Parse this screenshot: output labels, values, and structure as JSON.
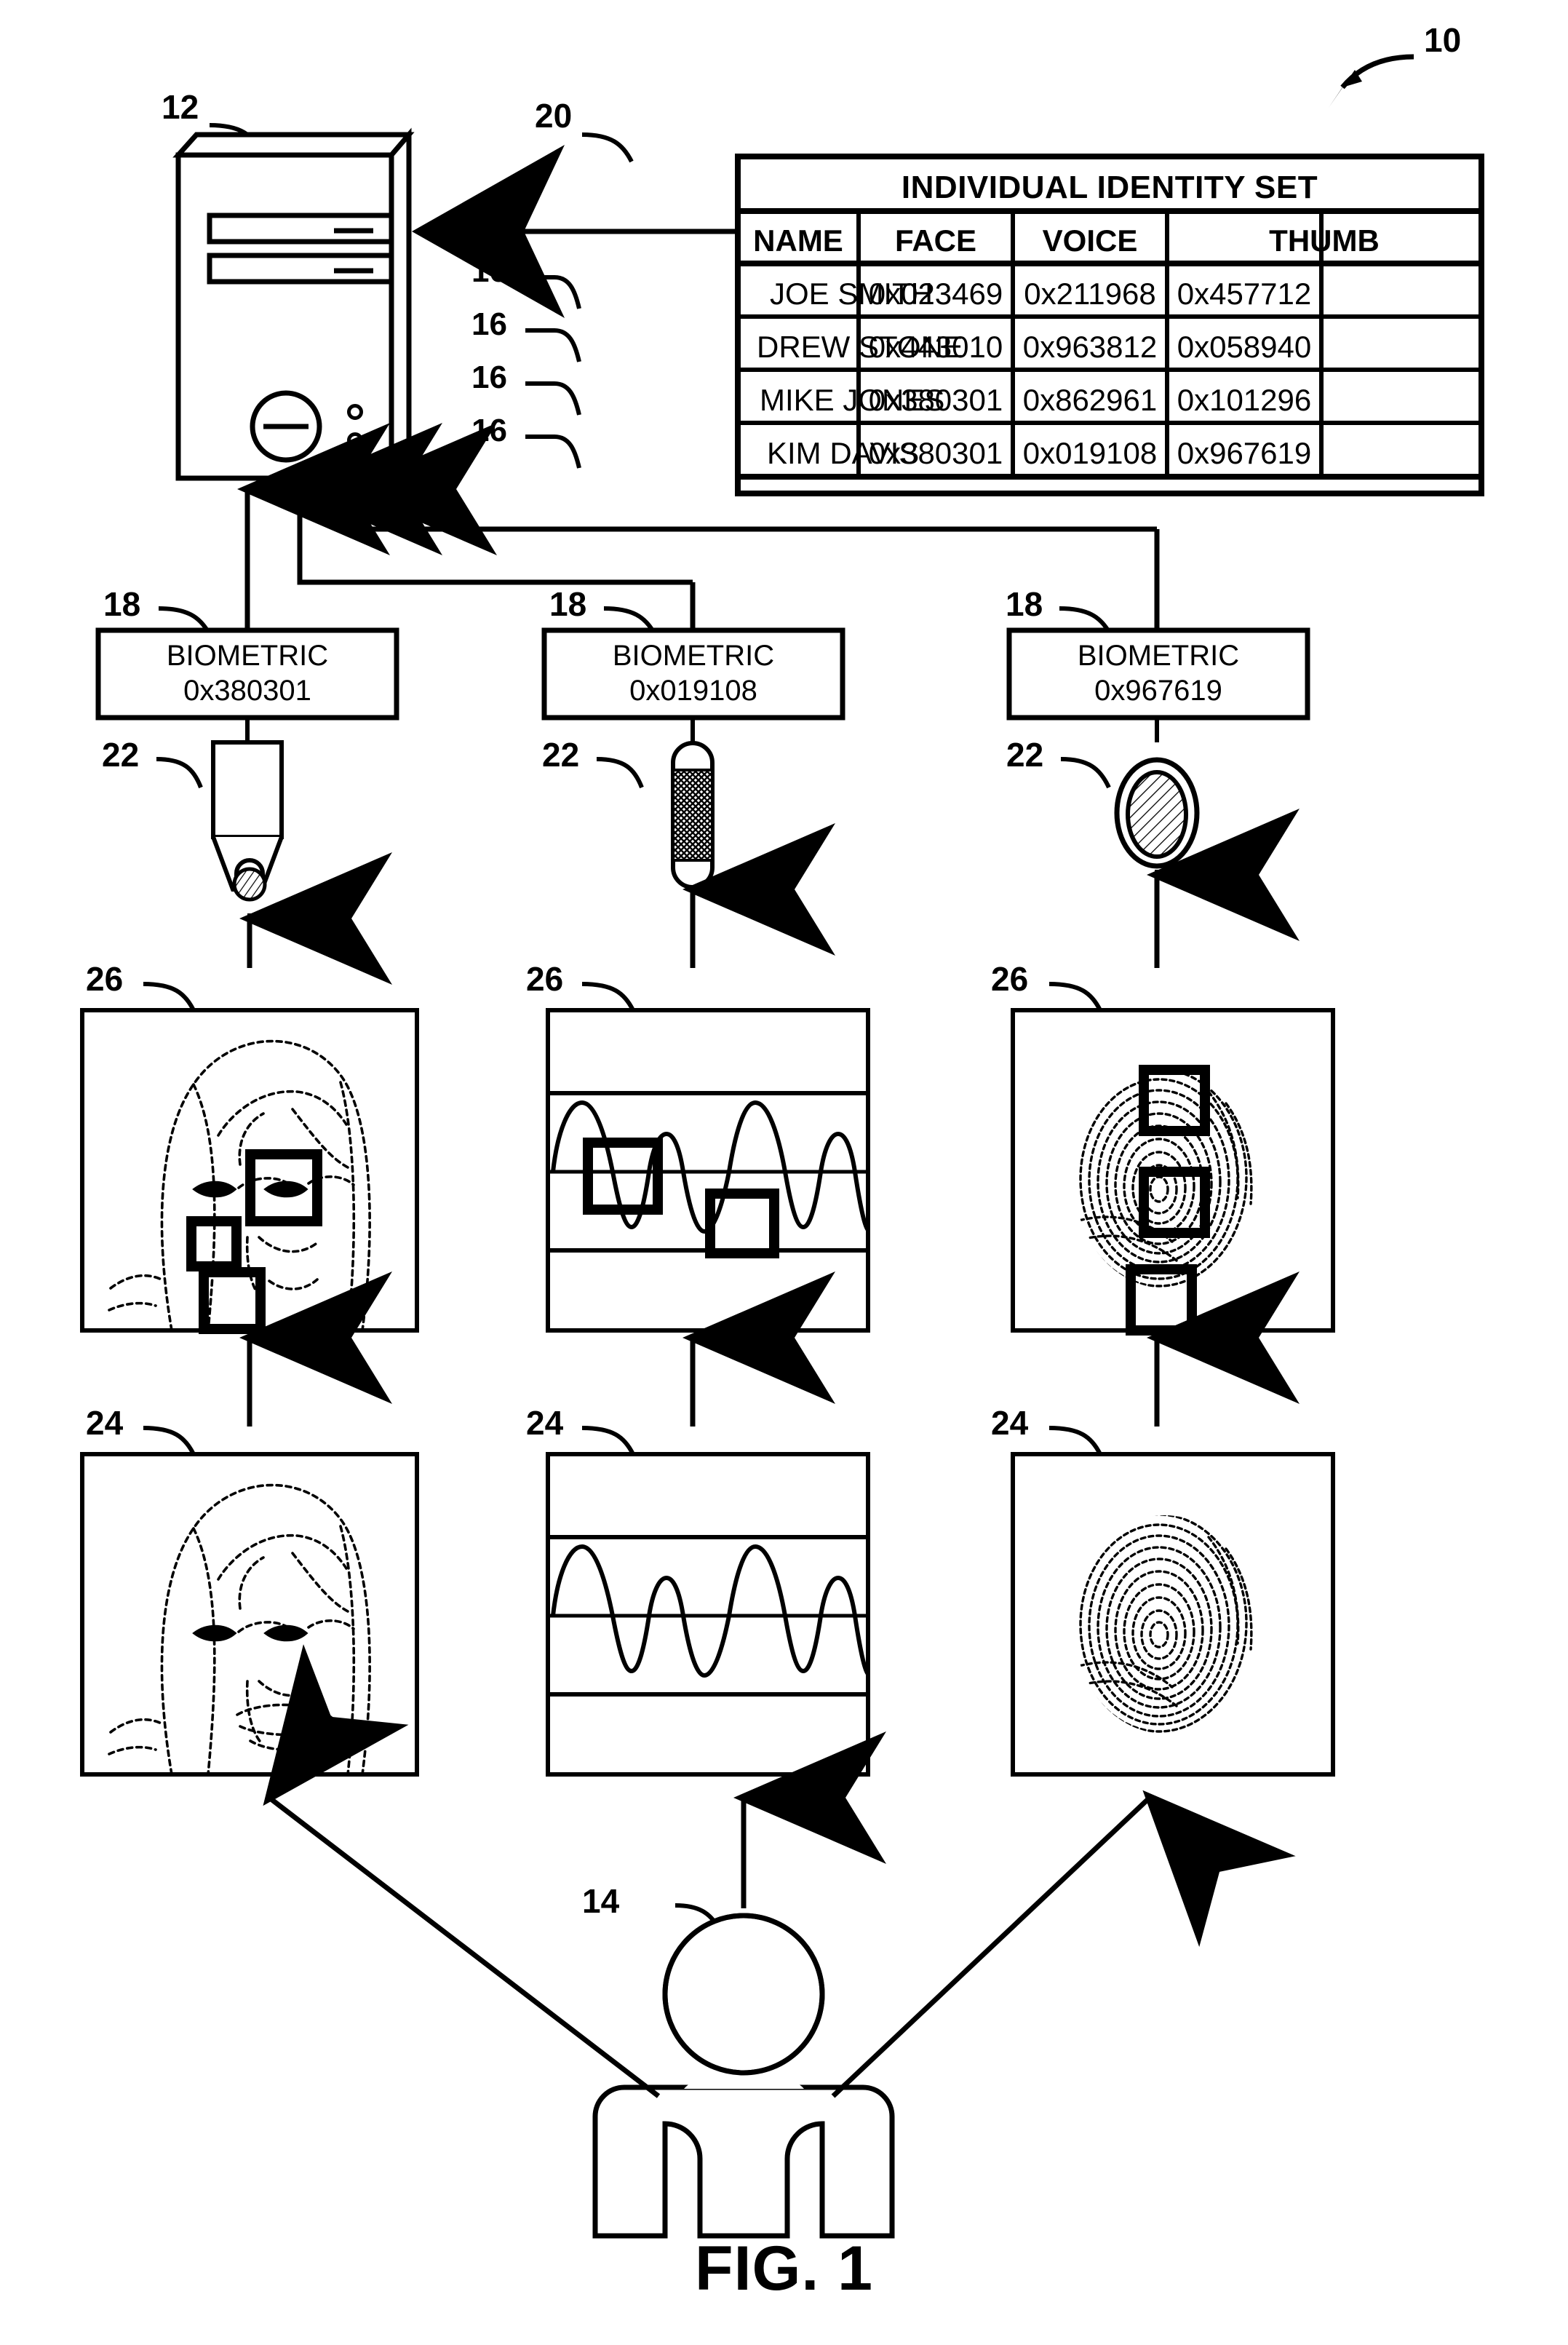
{
  "figure": {
    "caption": "FIG. 1",
    "system_ref": "10"
  },
  "computer": {
    "ref": "12",
    "name": "computer-tower"
  },
  "person": {
    "ref": "14",
    "name": "individual"
  },
  "identity_table": {
    "ref": "20",
    "row_ref": "16",
    "title": "INDIVIDUAL IDENTITY SET",
    "columns": [
      "NAME",
      "FACE",
      "VOICE",
      "THUMB"
    ],
    "rows": [
      {
        "name": "JOE SMITH",
        "face": "0x023469",
        "voice": "0x211968",
        "thumb": "0x457712"
      },
      {
        "name": "DREW STONE",
        "face": "0x443010",
        "voice": "0x963812",
        "thumb": "0x058940"
      },
      {
        "name": "MIKE JONES",
        "face": "0x380301",
        "voice": "0x862961",
        "thumb": "0x101296"
      },
      {
        "name": "KIM DAVIS",
        "face": "0x380301",
        "voice": "0x019108",
        "thumb": "0x967619"
      }
    ]
  },
  "biometric_blocks": {
    "ref": "18",
    "label": "BIOMETRIC",
    "items": [
      {
        "label": "BIOMETRIC",
        "value": "0x380301",
        "modality": "face"
      },
      {
        "label": "BIOMETRIC",
        "value": "0x019108",
        "modality": "voice"
      },
      {
        "label": "BIOMETRIC",
        "value": "0x967619",
        "modality": "thumb"
      }
    ]
  },
  "sensors": {
    "ref": "22",
    "items": [
      {
        "name": "camera-sensor"
      },
      {
        "name": "microphone-sensor"
      },
      {
        "name": "thumb-scanner-sensor"
      }
    ]
  },
  "feature_panels": {
    "ref": "26",
    "items": [
      {
        "name": "face-feature-panel",
        "boxes": 3
      },
      {
        "name": "voice-feature-panel",
        "boxes": 2
      },
      {
        "name": "thumb-feature-panel",
        "boxes": 3
      }
    ]
  },
  "capture_panels": {
    "ref": "24",
    "items": [
      {
        "name": "face-capture-panel"
      },
      {
        "name": "voice-capture-panel"
      },
      {
        "name": "thumb-capture-panel"
      }
    ]
  },
  "colors": {
    "ink": "#000000",
    "paper": "#ffffff"
  }
}
